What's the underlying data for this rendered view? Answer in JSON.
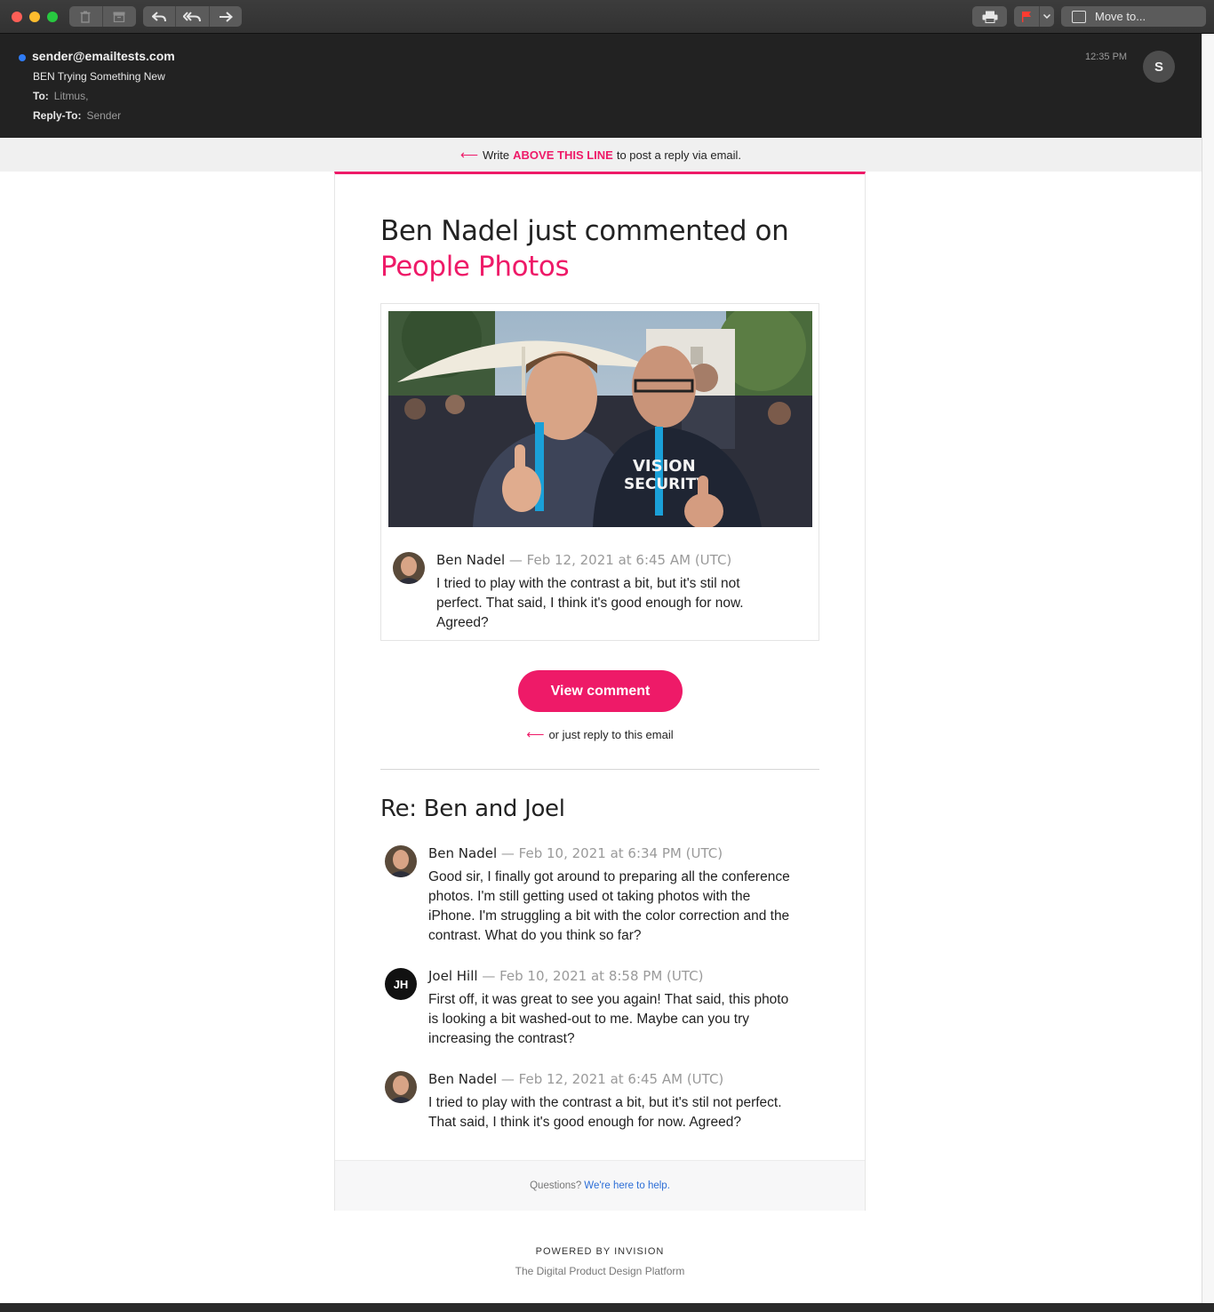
{
  "toolbar": {
    "move_to_label": "Move to..."
  },
  "header": {
    "sender": "sender@emailtests.com",
    "subject": "BEN Trying Something New",
    "to_label": "To:",
    "to_value": "Litmus,",
    "replyto_label": "Reply-To:",
    "replyto_value": "Sender",
    "time": "12:35 PM",
    "avatar_initial": "S"
  },
  "reply_line": {
    "prefix": "Write",
    "emphasis": "ABOVE THIS LINE",
    "suffix": "to post a reply via email.",
    "accent": "#ee1a68"
  },
  "email": {
    "title": "Ben Nadel just commented on",
    "title_link": "People Photos",
    "featured_comment": {
      "author": "Ben Nadel",
      "meta": "— Feb 12, 2021 at 6:45 AM (UTC)",
      "line1": "I tried to play with the contrast a bit, but it's stil not",
      "line2": "perfect. That said, I think it's good enough for now.",
      "line3": "Agreed?"
    },
    "view_button": "View comment",
    "or_reply": "or just reply to this email",
    "thread_title": "Re: Ben and Joel",
    "thread": [
      {
        "author": "Ben Nadel",
        "meta": "— Feb 10, 2021 at 6:34 PM (UTC)",
        "lines": [
          "Good sir, I finally got around to preparing all the conference",
          "photos. I'm still getting used ot taking photos with the",
          "iPhone. I'm struggling a bit with the color correction and the",
          "contrast. What do you think so far?"
        ]
      },
      {
        "author": "Joel Hill",
        "initials": "JH",
        "meta": "— Feb 10, 2021 at 8:58 PM (UTC)",
        "lines": [
          "First off, it was great to see you again! That said, this photo",
          "is looking a bit washed-out to me. Maybe can you try",
          "increasing the contrast?"
        ]
      },
      {
        "author": "Ben Nadel",
        "meta": "— Feb 12, 2021 at 6:45 AM (UTC)",
        "lines": [
          "I tried to play with the contrast a bit, but it's stil not perfect.",
          "That said, I think it's good enough for now. Agreed?"
        ]
      }
    ],
    "footer_question": "Questions?",
    "footer_help": "We're here to help.",
    "powered_by": "POWERED BY INVISION",
    "tagline": "The Digital Product Design Platform"
  }
}
